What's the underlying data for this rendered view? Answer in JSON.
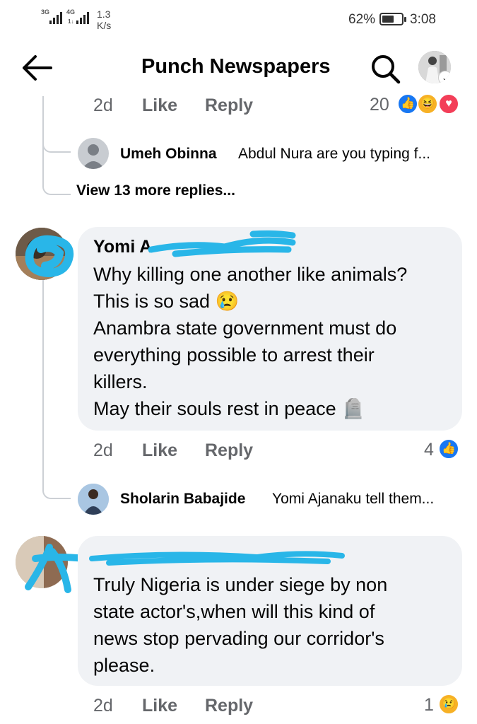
{
  "status_bar": {
    "network1": "3G",
    "network2": "4G",
    "network2_sub": "1↓",
    "speed_value": "1.3",
    "speed_unit": "K/s",
    "battery_percent": "62%",
    "battery_level": 0.62,
    "time": "3:08"
  },
  "header": {
    "title": "Punch Newspapers",
    "back_icon": "arrow-left-icon",
    "search_icon": "search-icon"
  },
  "comment0": {
    "time": "2d",
    "like_label": "Like",
    "reply_label": "Reply",
    "reaction_count": "20",
    "reactions": [
      "like",
      "haha",
      "love"
    ]
  },
  "reply0": {
    "name": "Umeh Obinna",
    "text": "Abdul Nura are you typing f..."
  },
  "view_more": "View 13 more replies...",
  "comment1": {
    "author_visible": "Yomi A",
    "lines": [
      "Why killing one another like animals?",
      "This is so sad 😢",
      "Anambra state government must do",
      "everything possible to arrest their",
      "killers.",
      "May their souls rest in peace 🪦"
    ],
    "time": "2d",
    "like_label": "Like",
    "reply_label": "Reply",
    "reaction_count": "4",
    "reactions": [
      "like"
    ]
  },
  "reply1": {
    "name": "Sholarin Babajide",
    "text": "Yomi Ajanaku tell them..."
  },
  "comment2": {
    "lines": [
      "Truly Nigeria is under siege by non",
      "state actor's,when will this kind of",
      "news stop pervading our corridor's",
      "please."
    ],
    "time": "2d",
    "like_label": "Like",
    "reply_label": "Reply",
    "reaction_count": "1",
    "reactions": [
      "sad"
    ]
  },
  "colors": {
    "accent": "#1877f2",
    "bubble": "#f0f2f5",
    "secondary_text": "#65676b",
    "scribble": "#29b6e8"
  }
}
